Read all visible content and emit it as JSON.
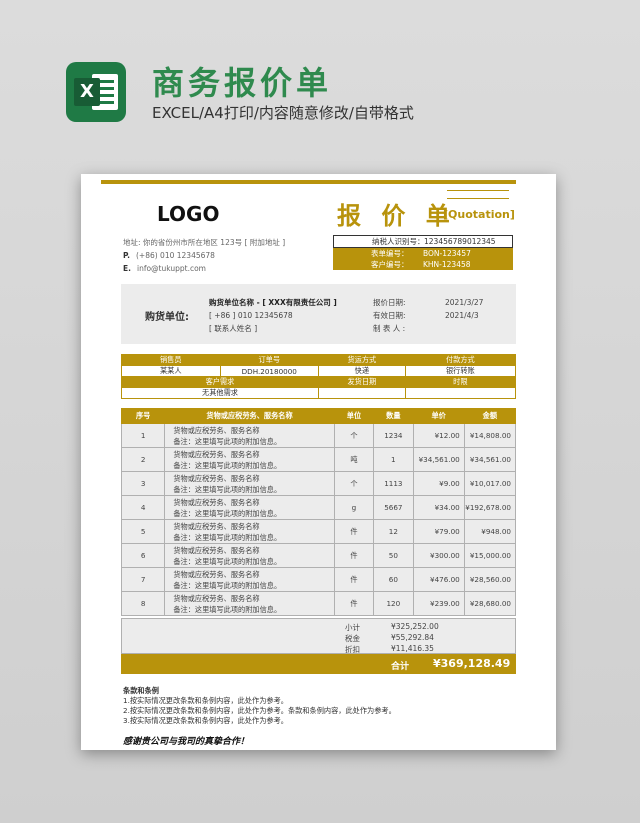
{
  "header": {
    "title": "商务报价单",
    "subtitle": "EXCEL/A4打印/内容随意修改/自带格式",
    "icon": "excel-icon",
    "icon_letter": "X"
  },
  "colors": {
    "accent": "#b8930c",
    "brand": "#1f7a45",
    "panel": "#ececec"
  },
  "doc": {
    "logo": "LOGO",
    "title": "报 价 单",
    "title_en": "[Quotation]",
    "contact": {
      "address_label": "地址:",
      "address": "你的省份州市所在地区 123号 [ 附加地址 ]",
      "phone_label": "P.",
      "phone": "(+86) 010 12345678",
      "email_label": "E.",
      "email": "info@tukuppt.com"
    },
    "ids": [
      {
        "label": "纳税人识别号：",
        "value": "123456789012345"
      },
      {
        "label": "表单编号：",
        "value": "BON-123457"
      },
      {
        "label": "客户编号：",
        "value": "KHN-123458"
      }
    ],
    "buyer": {
      "label": "购货单位:",
      "name": "购货单位名称 - [ XXX有限责任公司 ]",
      "phone": "[ +86 ] 010 12345678",
      "contact": "[ 联系人姓名 ]",
      "quote_date_label": "报价日期:",
      "quote_date": "2021/3/27",
      "valid_date_label": "有效日期:",
      "valid_date": "2021/4/3",
      "maker_label": "制 表 人 :",
      "maker": ""
    },
    "info": {
      "h1": [
        "销售员",
        "订单号",
        "货运方式",
        "付款方式"
      ],
      "v1": [
        "某某人",
        "DDH.20180000",
        "快递",
        "银行转账"
      ],
      "h2": [
        "客户需求",
        "发货日期",
        "时限"
      ],
      "v2": [
        "无其他需求",
        "",
        ""
      ]
    },
    "items": {
      "headers": [
        "序号",
        "货物或应税劳务、服务名称",
        "单位",
        "数量",
        "单价",
        "金额"
      ],
      "rows": [
        {
          "no": "1",
          "name": "货物或应税劳务、服务名称",
          "note": "备注：这里填写此项的附加信息。",
          "unit": "个",
          "qty": "1234",
          "price": "¥12.00",
          "amount": "¥14,808.00"
        },
        {
          "no": "2",
          "name": "货物或应税劳务、服务名称",
          "note": "备注：这里填写此项的附加信息。",
          "unit": "吨",
          "qty": "1",
          "price": "¥34,561.00",
          "amount": "¥34,561.00"
        },
        {
          "no": "3",
          "name": "货物或应税劳务、服务名称",
          "note": "备注：这里填写此项的附加信息。",
          "unit": "个",
          "qty": "1113",
          "price": "¥9.00",
          "amount": "¥10,017.00"
        },
        {
          "no": "4",
          "name": "货物或应税劳务、服务名称",
          "note": "备注：这里填写此项的附加信息。",
          "unit": "g",
          "qty": "5667",
          "price": "¥34.00",
          "amount": "¥192,678.00"
        },
        {
          "no": "5",
          "name": "货物或应税劳务、服务名称",
          "note": "备注：这里填写此项的附加信息。",
          "unit": "件",
          "qty": "12",
          "price": "¥79.00",
          "amount": "¥948.00"
        },
        {
          "no": "6",
          "name": "货物或应税劳务、服务名称",
          "note": "备注：这里填写此项的附加信息。",
          "unit": "件",
          "qty": "50",
          "price": "¥300.00",
          "amount": "¥15,000.00"
        },
        {
          "no": "7",
          "name": "货物或应税劳务、服务名称",
          "note": "备注：这里填写此项的附加信息。",
          "unit": "件",
          "qty": "60",
          "price": "¥476.00",
          "amount": "¥28,560.00"
        },
        {
          "no": "8",
          "name": "货物或应税劳务、服务名称",
          "note": "备注：这里填写此项的附加信息。",
          "unit": "件",
          "qty": "120",
          "price": "¥239.00",
          "amount": "¥28,680.00"
        }
      ]
    },
    "totals": {
      "subtotal_label": "小计",
      "subtotal": "¥325,252.00",
      "tax_label": "税金",
      "tax": "¥55,292.84",
      "discount_label": "折扣",
      "discount": "¥11,416.35",
      "total_label": "合计",
      "total": "¥369,128.49"
    },
    "terms": {
      "title": "条款和条例",
      "lines": [
        "1.按实际情况更改条款和条例内容，此处作为参考。",
        "2.按实际情况更改条款和条例内容，此处作为参考。条款和条例内容，此处作为参考。",
        "3.按实际情况更改条款和条例内容，此处作为参考。"
      ]
    },
    "thanks": "感谢贵公司与我司的真挚合作！"
  }
}
